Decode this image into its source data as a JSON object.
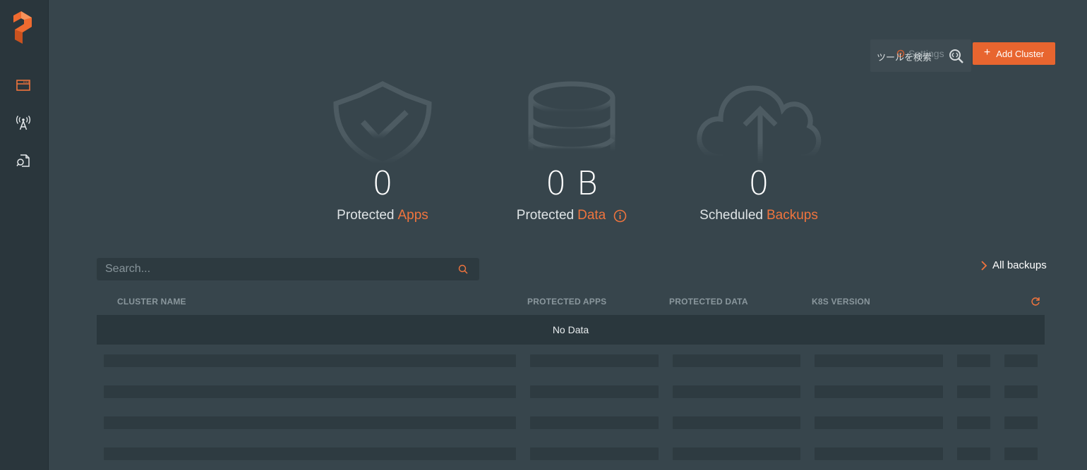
{
  "sidebar": {
    "logo": "portworx-logo",
    "items": [
      {
        "icon": "dashboard-icon",
        "active": true
      },
      {
        "icon": "antenna-icon",
        "active": false
      },
      {
        "icon": "document-search-icon",
        "active": false
      }
    ]
  },
  "header": {
    "settings_label": "Settings",
    "tool_search_label": "ツールを検索",
    "add_cluster_label": "Add Cluster",
    "add_cluster_plus": "+"
  },
  "stats": [
    {
      "value": "0",
      "label_prefix": "Protected",
      "label_accent": "Apps",
      "icon": "shield-check-icon"
    },
    {
      "value": "0 B",
      "label_prefix": "Protected",
      "label_accent": "Data",
      "icon": "database-icon",
      "info_icon": true
    },
    {
      "value": "0",
      "label_prefix": "Scheduled",
      "label_accent": "Backups",
      "icon": "cloud-upload-icon"
    }
  ],
  "search": {
    "placeholder": "Search...",
    "value": ""
  },
  "all_backups_label": "All backups",
  "table": {
    "columns": [
      "CLUSTER NAME",
      "PROTECTED APPS",
      "PROTECTED DATA",
      "K8S VERSION"
    ],
    "empty_text": "No Data"
  },
  "colors": {
    "accent": "#e8652f",
    "background": "#37454c",
    "sidebar": "#2a363c"
  }
}
